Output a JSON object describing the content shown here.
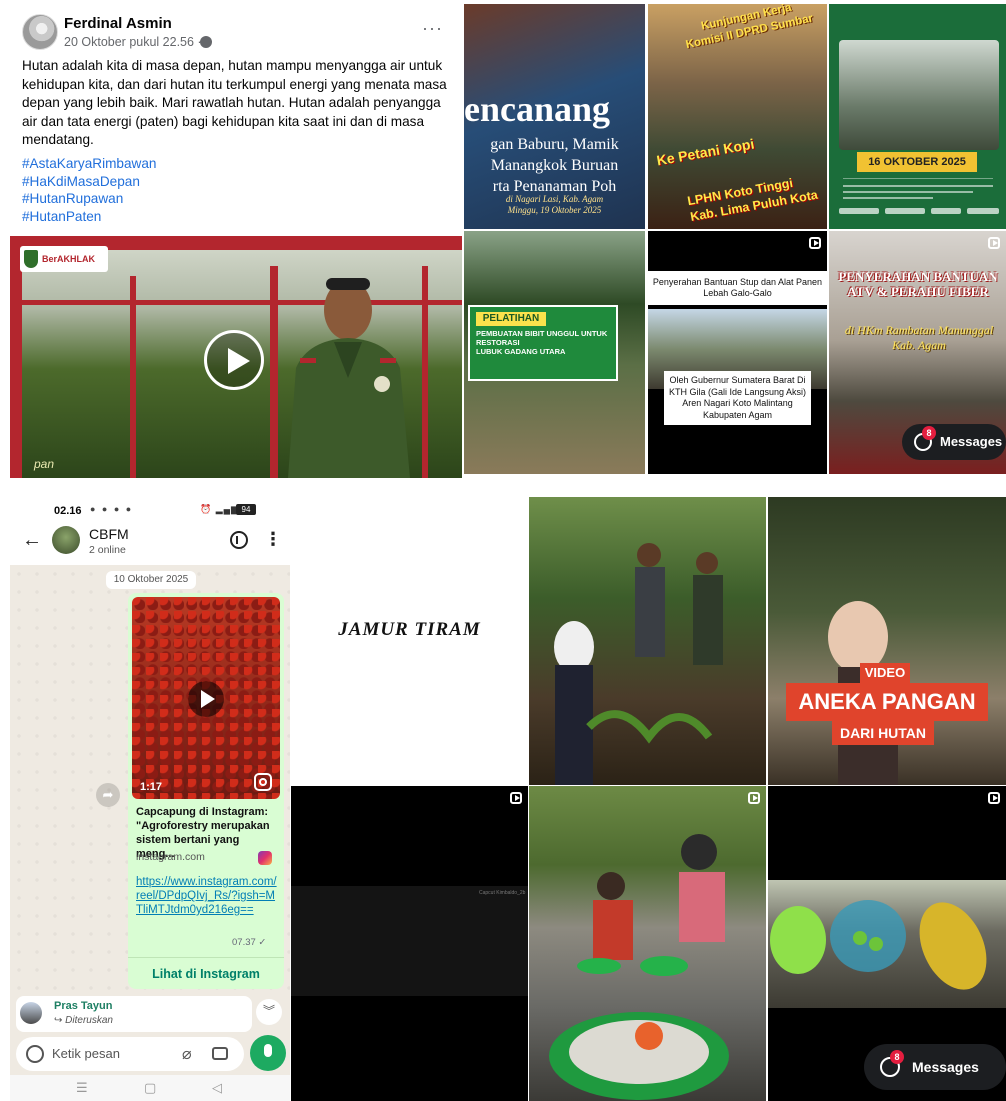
{
  "facebook_post": {
    "author": "Ferdinal Asmin",
    "date": "20 Oktober pukul 22.56 ·",
    "more": "···",
    "body": "Hutan adalah kita di masa depan, hutan mampu menyangga air untuk kehidupan kita, dan dari hutan itu terkumpul energi yang menata masa depan yang lebih baik. Mari rawatlah hutan. Hutan adalah penyangga air dan tata energi (paten) bagi kehidupan kita saat ini dan di masa mendatang.",
    "hashtags": [
      "#AstaKaryaRimbawan",
      "#HaKdiMasaDepan",
      "#HutanRupawan",
      "#HutanPaten"
    ],
    "video_logo": "BerAKHLAK",
    "video_watermark": "pan"
  },
  "reels_top": [
    {
      "big": "encanang",
      "lines": [
        "gan Baburu, Mamik",
        "Manangkok Buruan",
        "rta Penanaman Poh"
      ],
      "footer": [
        "di Nagari Lasi, Kab. Agam",
        "Minggu, 19 Oktober 2025"
      ]
    },
    {
      "title": [
        "Kunjungan Kerja",
        "Komisi II DPRD Sumbar"
      ],
      "mid": "Ke Petani Kopi",
      "bottom": [
        "LPHN Koto Tinggi",
        "Kab. Lima Puluh Kota"
      ]
    },
    {
      "date": "16 OKTOBER 2025"
    },
    {
      "title": "PELATIHAN",
      "subtitle": "PEMBUATAN BIBIT UNGGUL UNTUK RESTORASI",
      "subtitle2": "LUBUK GADANG UTARA"
    },
    {
      "caption_top": "Penyerahan Bantuan Stup dan Alat Panen Lebah Galo-Galo",
      "caption_bottom": "Oleh Gubernur Sumatera Barat Di KTH Gila (Gali Ide Langsung Aksi) Aren Nagari Koto Malintang Kabupaten Agam"
    },
    {
      "title": "PENYERAHAN BANTUAN ATV & PERAHU FIBER",
      "subtitle": "di HKm Rambatan Manunggal Kab. Agam"
    }
  ],
  "messages_button": {
    "label": "Messages",
    "badge": "8"
  },
  "whatsapp": {
    "time": "02.16",
    "status_battery": "94",
    "chat_name": "CBFM",
    "chat_status": "2 online",
    "date_chip": "10 Oktober 2025",
    "reel_duration": "1:17",
    "link_title": "Capcapung di Instagram: \"Agroforestry merupakan sistem bertani yang meng...",
    "link_domain": "instagram.com",
    "link_url": "https://www.instagram.com/reel/DPdpQIvj_Rs/?igsh=MTliMTJtdm0yd216eg==",
    "message_time": "07.37 ✓",
    "open_label": "Lihat di Instagram",
    "reply_name": "Pras Tayun",
    "reply_sub": "Diteruskan",
    "input_placeholder": "Ketik pesan"
  },
  "grid_bottom": {
    "jamur": "JAMUR TIRAM",
    "video_label": "VIDEO",
    "aneka": "ANEKA PANGAN",
    "dari": "DARI HUTAN",
    "dark_caption": "Capcut Kimbaldo_2b"
  }
}
